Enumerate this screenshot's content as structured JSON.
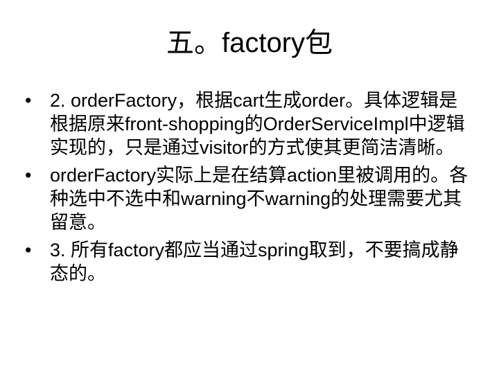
{
  "slide": {
    "title": "五。factory包",
    "bullet_symbol": "•",
    "bullets": [
      {
        "text": "2. orderFactory，根据cart生成order。具体逻辑是根据原来front-shopping的OrderServiceImpl中逻辑实现的，只是通过visitor的方式使其更简洁清晰。"
      },
      {
        "text": "orderFactory实际上是在结算action里被调用的。各种选中不选中和warning不warning的处理需要尤其留意。"
      },
      {
        "text": "3. 所有factory都应当通过spring取到，不要搞成静态的。"
      }
    ]
  }
}
